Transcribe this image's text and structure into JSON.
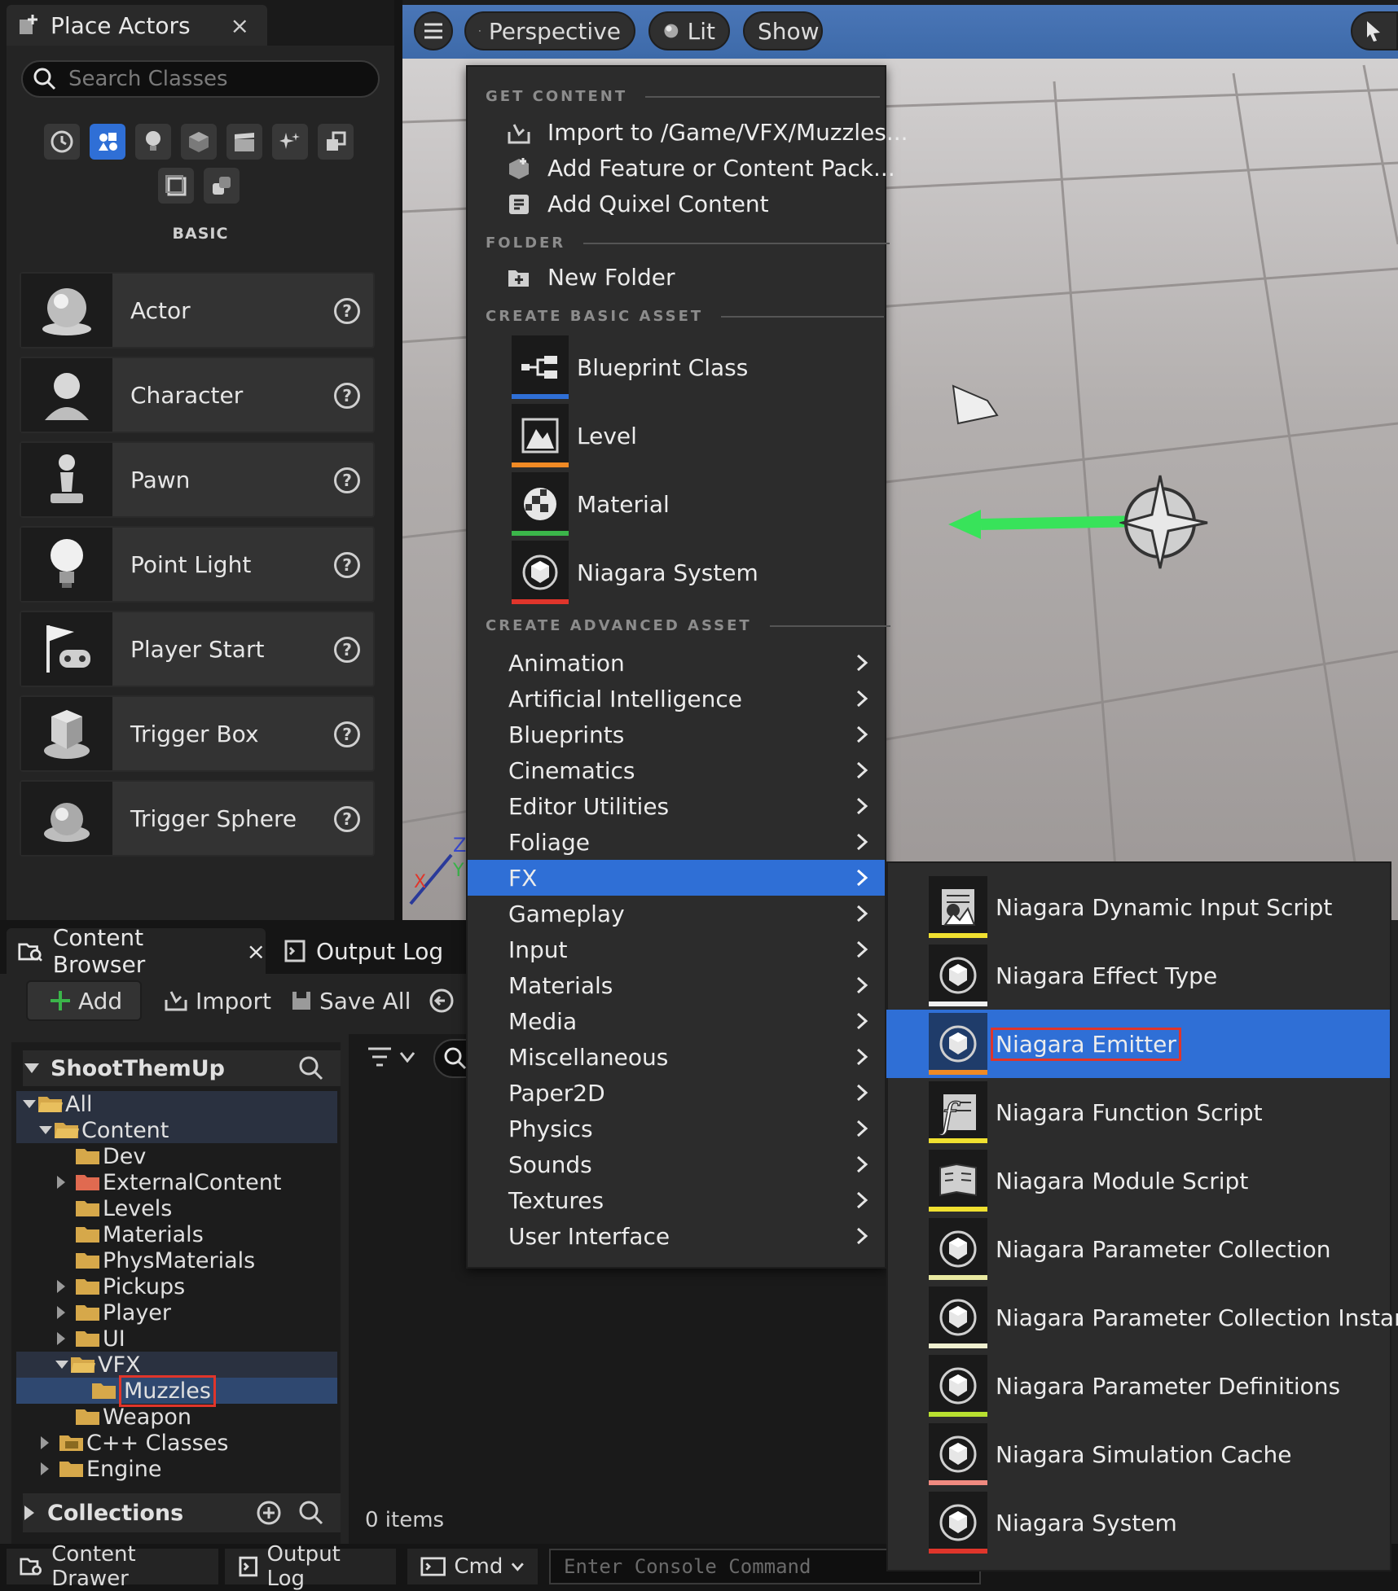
{
  "place_actors": {
    "tab_title": "Place Actors",
    "close": "×",
    "search_placeholder": "Search Classes",
    "category": "BASIC",
    "items": [
      {
        "label": "Actor"
      },
      {
        "label": "Character"
      },
      {
        "label": "Pawn"
      },
      {
        "label": "Point Light"
      },
      {
        "label": "Player Start"
      },
      {
        "label": "Trigger Box"
      },
      {
        "label": "Trigger Sphere"
      }
    ],
    "help": "?"
  },
  "viewport": {
    "perspective": "Perspective",
    "lit": "Lit",
    "show": "Show"
  },
  "menu": {
    "get_content": {
      "header": "GET CONTENT",
      "items": [
        "Import to /Game/VFX/Muzzles...",
        "Add Feature or Content Pack...",
        "Add Quixel Content"
      ]
    },
    "folder": {
      "header": "FOLDER",
      "items": [
        "New Folder"
      ]
    },
    "basic": {
      "header": "CREATE BASIC ASSET",
      "items": [
        {
          "label": "Blueprint Class",
          "color": "#2f6fd6"
        },
        {
          "label": "Level",
          "color": "#f08a24"
        },
        {
          "label": "Material",
          "color": "#3bb54a"
        },
        {
          "label": "Niagara System",
          "color": "#e0352b"
        }
      ]
    },
    "advanced": {
      "header": "CREATE ADVANCED ASSET",
      "items": [
        "Animation",
        "Artificial Intelligence",
        "Blueprints",
        "Cinematics",
        "Editor Utilities",
        "Foliage",
        "FX",
        "Gameplay",
        "Input",
        "Materials",
        "Media",
        "Miscellaneous",
        "Paper2D",
        "Physics",
        "Sounds",
        "Textures",
        "User Interface"
      ],
      "highlighted": "FX"
    }
  },
  "submenu": {
    "items": [
      {
        "label": "Niagara Dynamic Input Script",
        "color": "#f0e030"
      },
      {
        "label": "Niagara Effect Type",
        "color": "#f0f0f0"
      },
      {
        "label": "Niagara Emitter",
        "color": "#f08a24"
      },
      {
        "label": "Niagara Function Script",
        "color": "#f0e030"
      },
      {
        "label": "Niagara Module Script",
        "color": "#f0e030"
      },
      {
        "label": "Niagara Parameter Collection",
        "color": "#e8e8a0"
      },
      {
        "label": "Niagara Parameter Collection Instance",
        "color": "#f0f0d0"
      },
      {
        "label": "Niagara Parameter Definitions",
        "color": "#b8e030"
      },
      {
        "label": "Niagara Simulation Cache",
        "color": "#f08a80"
      },
      {
        "label": "Niagara System",
        "color": "#e0352b"
      }
    ],
    "highlighted": "Niagara Emitter"
  },
  "content_browser": {
    "tab_title": "Content Browser",
    "close": "×",
    "output_log_tab": "Output Log",
    "add": "Add",
    "import": "Import",
    "save_all": "Save All",
    "project": "ShootThemUp",
    "tree": [
      "All",
      "Content",
      "Dev",
      "ExternalContent",
      "Levels",
      "Materials",
      "PhysMaterials",
      "Pickups",
      "Player",
      "UI",
      "VFX",
      "Muzzles",
      "Weapon",
      "C++ Classes",
      "Engine"
    ],
    "collections": "Collections",
    "items_count": "0 items"
  },
  "bottom_bar": {
    "content_drawer": "Content Drawer",
    "output_log": "Output Log",
    "cmd": "Cmd",
    "console_placeholder": "Enter Console Command"
  }
}
